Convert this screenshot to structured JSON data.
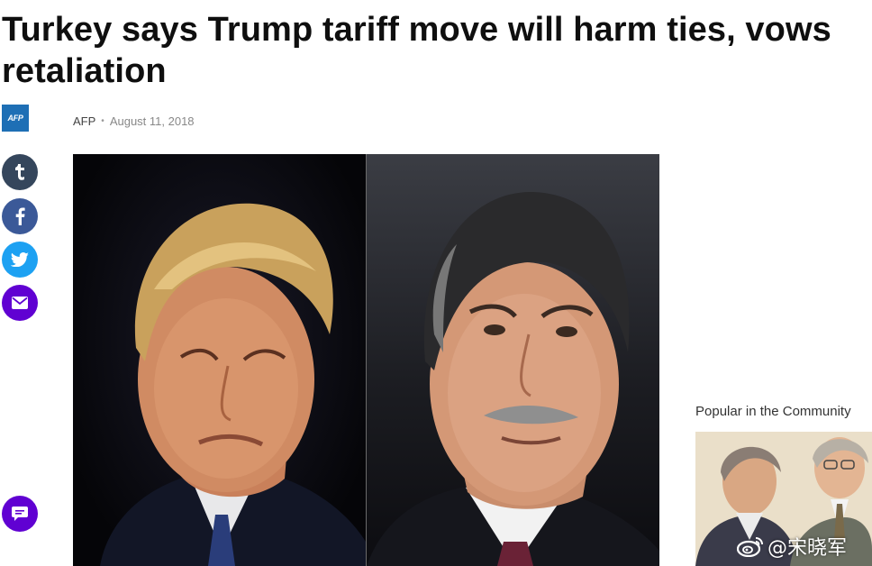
{
  "article": {
    "headline": "Turkey says Trump tariff move will harm ties, vows retaliation",
    "provider_logo_text": "AFP",
    "provider": "AFP",
    "date": "August 11, 2018"
  },
  "share_buttons": [
    {
      "name": "tumblr",
      "color": "#35465c",
      "icon": "tumblr-icon"
    },
    {
      "name": "facebook",
      "color": "#3b5998",
      "icon": "facebook-icon"
    },
    {
      "name": "twitter",
      "color": "#1da1f2",
      "icon": "twitter-icon"
    },
    {
      "name": "email",
      "color": "#6001d2",
      "icon": "mail-icon"
    }
  ],
  "comments_button": {
    "color": "#6001d2",
    "icon": "comment-icon"
  },
  "sidebar": {
    "popular_title": "Popular in the Community"
  },
  "watermark": {
    "text": "@宋晓军",
    "icon": "weibo-icon"
  }
}
